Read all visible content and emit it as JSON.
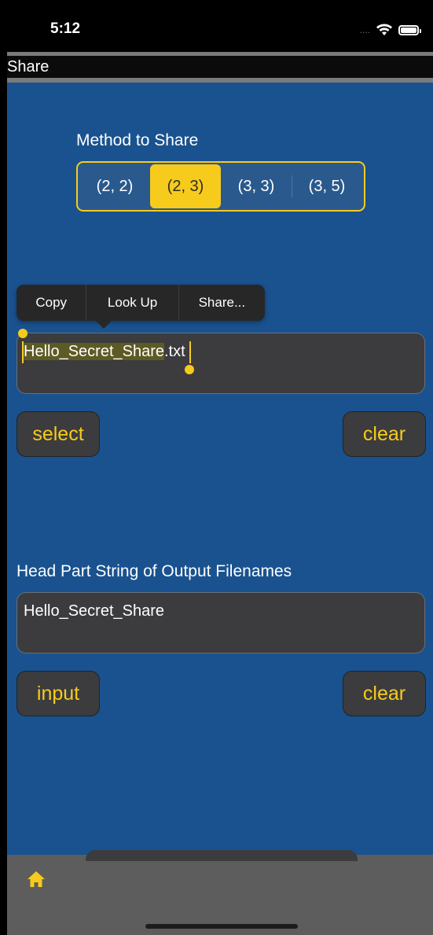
{
  "status_bar": {
    "time": "5:12",
    "signal": "....",
    "icons": [
      "wifi-icon",
      "battery-icon"
    ]
  },
  "title_bar": {
    "title": "Share"
  },
  "method_section": {
    "label": "Method to Share",
    "options": [
      "(2, 2)",
      "(2, 3)",
      "(3, 3)",
      "(3, 5)"
    ],
    "selected_index": 1
  },
  "context_menu": {
    "items": [
      "Copy",
      "Look Up",
      "Share..."
    ]
  },
  "file_field": {
    "selected_text": "Hello_Secret_Share",
    "rest_text": ".txt"
  },
  "file_buttons": {
    "select_label": "select",
    "clear_label": "clear"
  },
  "output_section": {
    "label": "Head Part String of Output Filenames",
    "value": "Hello_Secret_Share",
    "input_label": "input",
    "clear_label": "clear"
  },
  "tab_bar": {
    "icon": "home-icon"
  },
  "colors": {
    "accent": "#f7cb1c",
    "background": "#19528f",
    "field": "#3c3c3e",
    "tab_bar": "#5d5d5d"
  }
}
